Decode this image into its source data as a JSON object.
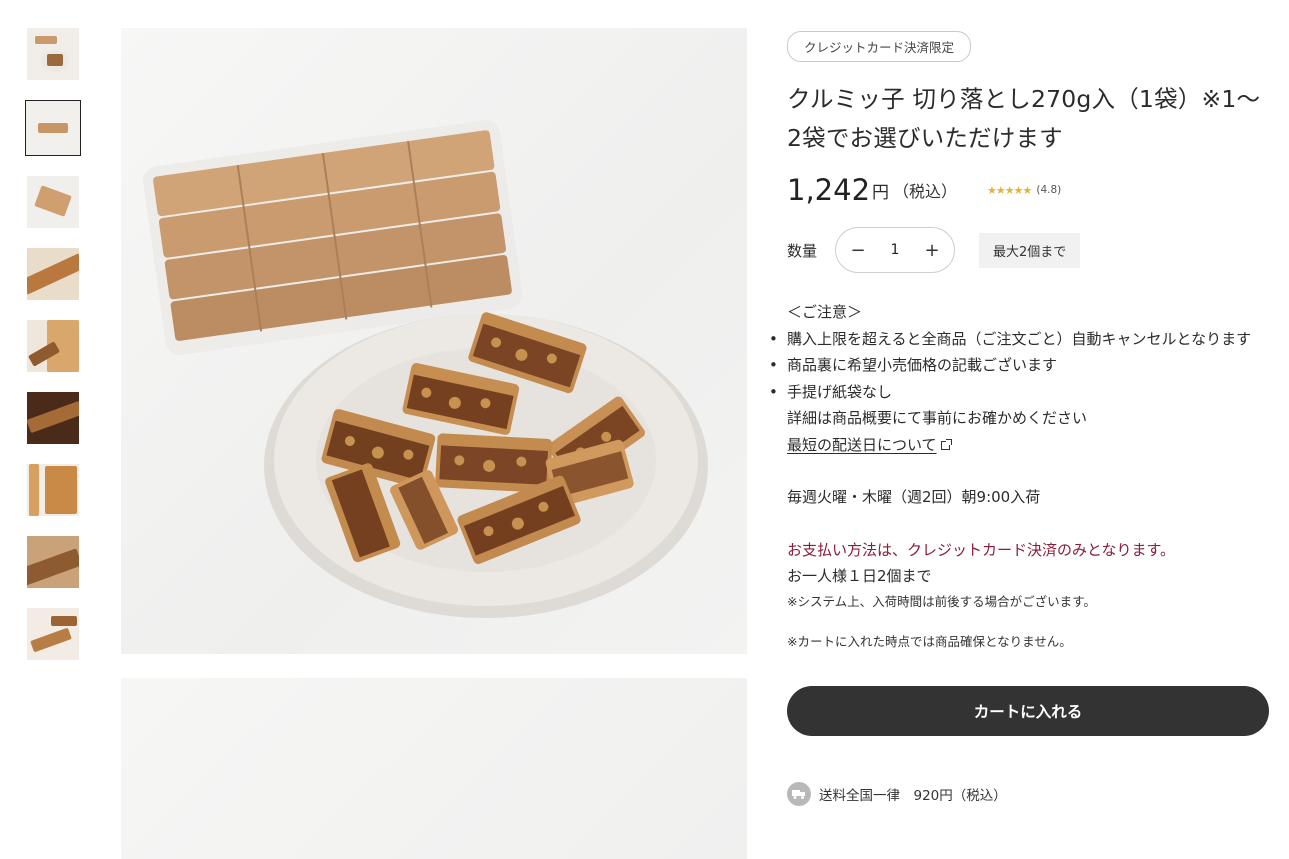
{
  "thumbnails": [
    {
      "label": "thumbnail-1"
    },
    {
      "label": "thumbnail-2"
    },
    {
      "label": "thumbnail-3"
    },
    {
      "label": "thumbnail-4"
    },
    {
      "label": "thumbnail-5"
    },
    {
      "label": "thumbnail-6"
    },
    {
      "label": "thumbnail-7"
    },
    {
      "label": "thumbnail-8"
    },
    {
      "label": "thumbnail-9"
    }
  ],
  "product": {
    "badge": "クレジットカード決済限定",
    "title": "クルミッ子 切り落とし270g入（1袋）※1〜2袋でお選びいただけます",
    "price": "1,242",
    "yen": "円",
    "tax": "（税込）",
    "stars": "★★★★★",
    "rating": "(4.8)"
  },
  "quantity": {
    "label": "数量",
    "minus": "−",
    "value": "1",
    "plus": "+",
    "max_note": "最大2個まで"
  },
  "notes": {
    "heading": "＜ご注意＞",
    "items": [
      "購入上限を超えると全商品（ご注文ごと）自動キャンセルとなります",
      "商品裏に希望小売価格の記載ございます",
      "手提げ紙袋なし"
    ],
    "detail": "詳細は商品概要にて事前にお確かめください",
    "shipping_link": "最短の配送日について",
    "arrival": "毎週火曜・木曜（週2回）朝9:00入荷",
    "payment": "お支払い方法は、クレジットカード決済のみとなります。",
    "per_person": "お一人様１日2個まで",
    "system": "※システム上、入荷時間は前後する場合がございます。",
    "cart_note": "※カートに入れた時点では商品確保となりません。"
  },
  "cart_button": "カートに入れる",
  "shipping": {
    "text": "送料全国一律　920円（税込）",
    "icon": "truck-icon"
  },
  "colors": {
    "accent_payment": "#8a1c3a",
    "button_bg": "#333333",
    "star": "#e3b23c"
  }
}
